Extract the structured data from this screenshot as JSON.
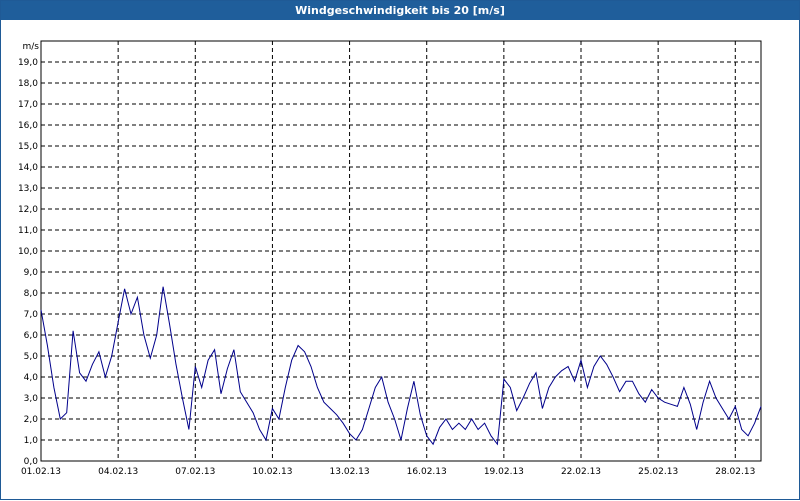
{
  "window": {
    "title": "Windgeschwindigkeit bis 20 [m/s]"
  },
  "colors": {
    "titlebar": "#1f5e9b",
    "series": "#00008b",
    "grid": "#000000",
    "background": "#ffffff"
  },
  "chart_data": {
    "type": "line",
    "title": "Windgeschwindigkeit bis 20 [m/s]",
    "ylabel": "m/s",
    "xlabel": "",
    "ylim": [
      0,
      20
    ],
    "xlim": [
      "01.02.13",
      "01.03.13"
    ],
    "grid": true,
    "legend": "none",
    "y_ticks": [
      "0,0",
      "1,0",
      "2,0",
      "3,0",
      "4,0",
      "5,0",
      "6,0",
      "7,0",
      "8,0",
      "9,0",
      "10,0",
      "11,0",
      "12,0",
      "13,0",
      "14,0",
      "15,0",
      "16,0",
      "17,0",
      "18,0",
      "19,0"
    ],
    "x_ticks": [
      "01.02.13",
      "04.02.13",
      "07.02.13",
      "10.02.13",
      "13.02.13",
      "16.02.13",
      "19.02.13",
      "22.02.13",
      "25.02.13",
      "28.02.13"
    ],
    "series": [
      {
        "x": [
          "01.02.13 00:00",
          "01.02.13 06:00",
          "01.02.13 12:00",
          "01.02.13 18:00",
          "02.02.13 00:00",
          "02.02.13 06:00",
          "02.02.13 12:00",
          "02.02.13 18:00",
          "03.02.13 00:00",
          "03.02.13 06:00",
          "03.02.13 12:00",
          "03.02.13 18:00",
          "04.02.13 00:00",
          "04.02.13 06:00",
          "04.02.13 12:00",
          "04.02.13 18:00",
          "05.02.13 00:00",
          "05.02.13 06:00",
          "05.02.13 12:00",
          "05.02.13 18:00",
          "06.02.13 00:00",
          "06.02.13 06:00",
          "06.02.13 12:00",
          "06.02.13 18:00",
          "07.02.13 00:00",
          "07.02.13 06:00",
          "07.02.13 12:00",
          "07.02.13 18:00",
          "08.02.13 00:00",
          "08.02.13 06:00",
          "08.02.13 12:00",
          "08.02.13 18:00",
          "09.02.13 00:00",
          "09.02.13 06:00",
          "09.02.13 12:00",
          "09.02.13 18:00",
          "10.02.13 00:00",
          "10.02.13 06:00",
          "10.02.13 12:00",
          "10.02.13 18:00",
          "11.02.13 00:00",
          "11.02.13 06:00",
          "11.02.13 12:00",
          "11.02.13 18:00",
          "12.02.13 00:00",
          "12.02.13 06:00",
          "12.02.13 12:00",
          "12.02.13 18:00",
          "13.02.13 00:00",
          "13.02.13 06:00",
          "13.02.13 12:00",
          "13.02.13 18:00",
          "14.02.13 00:00",
          "14.02.13 06:00",
          "14.02.13 12:00",
          "14.02.13 18:00",
          "15.02.13 00:00",
          "15.02.13 06:00",
          "15.02.13 12:00",
          "15.02.13 18:00",
          "16.02.13 00:00",
          "16.02.13 06:00",
          "16.02.13 12:00",
          "16.02.13 18:00",
          "17.02.13 00:00",
          "17.02.13 06:00",
          "17.02.13 12:00",
          "17.02.13 18:00",
          "18.02.13 00:00",
          "18.02.13 06:00",
          "18.02.13 12:00",
          "18.02.13 18:00",
          "19.02.13 00:00",
          "19.02.13 06:00",
          "19.02.13 12:00",
          "19.02.13 18:00",
          "20.02.13 00:00",
          "20.02.13 06:00",
          "20.02.13 12:00",
          "20.02.13 18:00",
          "21.02.13 00:00",
          "21.02.13 06:00",
          "21.02.13 12:00",
          "21.02.13 18:00",
          "22.02.13 00:00",
          "22.02.13 06:00",
          "22.02.13 12:00",
          "22.02.13 18:00",
          "23.02.13 00:00",
          "23.02.13 06:00",
          "23.02.13 12:00",
          "23.02.13 18:00",
          "24.02.13 00:00",
          "24.02.13 06:00",
          "24.02.13 12:00",
          "24.02.13 18:00",
          "25.02.13 00:00",
          "25.02.13 06:00",
          "25.02.13 12:00",
          "25.02.13 18:00",
          "26.02.13 00:00",
          "26.02.13 06:00",
          "26.02.13 12:00",
          "26.02.13 18:00",
          "27.02.13 00:00",
          "27.02.13 06:00",
          "27.02.13 12:00",
          "27.02.13 18:00",
          "28.02.13 00:00",
          "28.02.13 06:00",
          "28.02.13 12:00",
          "28.02.13 18:00",
          "01.03.13 00:00"
        ],
        "values": [
          7.2,
          5.5,
          3.5,
          2.0,
          2.3,
          6.2,
          4.2,
          3.8,
          4.6,
          5.2,
          4.0,
          5.0,
          6.6,
          8.2,
          7.0,
          7.8,
          6.0,
          4.9,
          6.0,
          8.3,
          6.5,
          4.6,
          3.0,
          1.5,
          4.5,
          3.5,
          4.8,
          5.3,
          3.2,
          4.4,
          5.3,
          3.3,
          2.8,
          2.3,
          1.5,
          1.0,
          2.5,
          2.0,
          3.5,
          4.8,
          5.5,
          5.2,
          4.5,
          3.5,
          2.8,
          2.5,
          2.2,
          1.8,
          1.3,
          1.0,
          1.5,
          2.5,
          3.5,
          4.0,
          2.8,
          2.0,
          1.0,
          2.5,
          3.8,
          2.2,
          1.2,
          0.8,
          1.6,
          2.0,
          1.5,
          1.8,
          1.5,
          2.0,
          1.5,
          1.8,
          1.2,
          0.8,
          3.9,
          3.5,
          2.4,
          3.0,
          3.7,
          4.2,
          2.5,
          3.5,
          4.0,
          4.3,
          4.5,
          3.8,
          4.8,
          3.5,
          4.5,
          5.0,
          4.6,
          4.0,
          3.3,
          3.8,
          3.8,
          3.2,
          2.8,
          3.4,
          3.0,
          2.8,
          2.7,
          2.6,
          3.5,
          2.7,
          1.5,
          2.8,
          3.8,
          3.0,
          2.5,
          2.0,
          2.6,
          1.5,
          1.2,
          1.8,
          2.6
        ]
      }
    ]
  }
}
